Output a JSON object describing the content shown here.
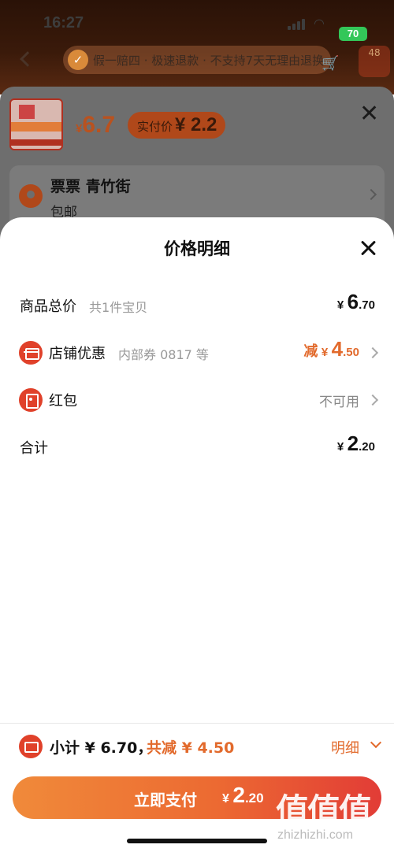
{
  "status_bar": {
    "time": "16:27",
    "battery": "70"
  },
  "background_page": {
    "guarantee_text": "假一赔四 · 极速退款 · 不支持7天无理由退换",
    "badge": "48",
    "price_currency": "¥",
    "price": "6.7",
    "real_price_label": "实付价",
    "real_price": "¥ 2.2",
    "address_name": "票票  青竹街",
    "shipping": "包邮"
  },
  "sheet": {
    "title": "价格明细",
    "rows": {
      "total": {
        "label": "商品总价",
        "sub": "共1件宝贝",
        "currency": "¥",
        "int": "6",
        "dec": ".70"
      },
      "shop_discount": {
        "label": "店铺优惠",
        "sub": "内部券 0817 等",
        "prefix": "减",
        "currency": "¥",
        "int": "4",
        "dec": ".50"
      },
      "red_packet": {
        "label": "红包",
        "status": "不可用"
      },
      "sum": {
        "label": "合计",
        "currency": "¥",
        "int": "2",
        "dec": ".20"
      }
    }
  },
  "bottom_bar": {
    "subtotal": "小计 ¥ 6.70，",
    "discount": "共减 ¥ 4.50",
    "detail": "明细",
    "pay_label": "立即支付",
    "pay_currency": "¥",
    "pay_int": "2",
    "pay_dec": ".20"
  },
  "watermark": {
    "logo": "值值值",
    "url": "zhizhizhi.com"
  },
  "colors": {
    "accent": "#e26a2c",
    "pay_gradient_start": "#f08a3a",
    "pay_gradient_end": "#e23c36",
    "icon_red": "#e0412a"
  }
}
